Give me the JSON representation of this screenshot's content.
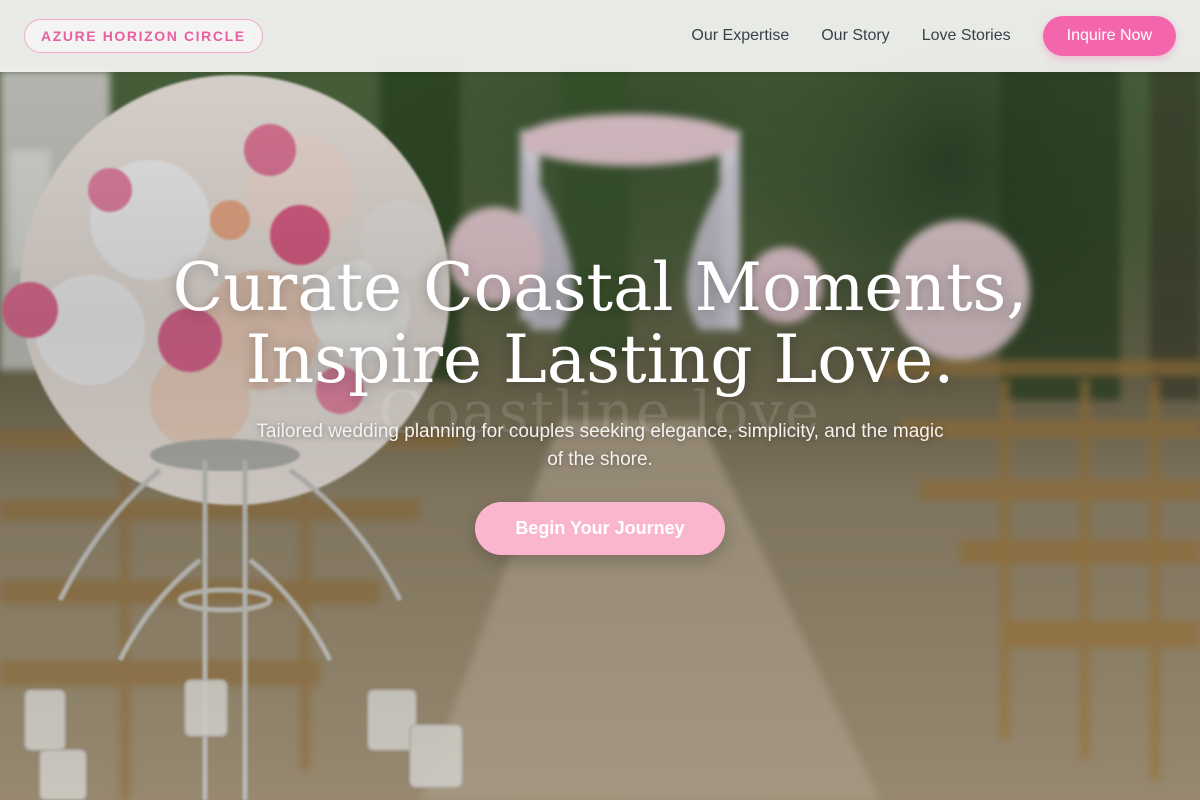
{
  "header": {
    "logo": "AZURE HORIZON CIRCLE",
    "nav": [
      {
        "label": "Our Expertise"
      },
      {
        "label": "Our Story"
      },
      {
        "label": "Love Stories"
      }
    ],
    "cta_label": "Inquire Now"
  },
  "hero": {
    "headline_line1": "Curate Coastal Moments,",
    "headline_line2": "Inspire Lasting Love.",
    "subtitle": "Tailored wedding planning for couples seeking elegance, simplicity, and the magic of the shore.",
    "cta_label": "Begin Your Journey",
    "watermark": "Coastline love"
  },
  "colors": {
    "accent_pink": "#f466ab",
    "logo_pink": "#e85fa3",
    "cta_soft_pink": "#fbb6cf",
    "header_bg": "#f5f5f3",
    "nav_text": "#3b3f4a"
  }
}
